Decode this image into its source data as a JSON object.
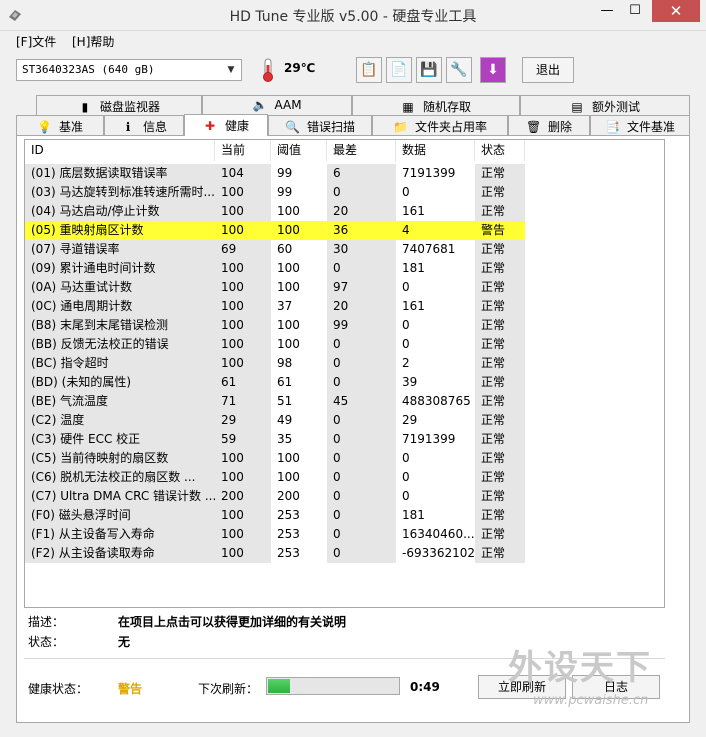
{
  "window": {
    "title": "HD Tune 专业版 v5.00 - 硬盘专业工具",
    "min": "—",
    "max": "☐",
    "close": "✕"
  },
  "menu": {
    "file": "[F]文件",
    "help": "[H]帮助"
  },
  "toolbar": {
    "drive": "ST3640323AS (640 gB)",
    "temperature": "29℃",
    "exit_label": "退出"
  },
  "tabs_top": [
    {
      "label": "磁盘监视器",
      "icon": "bar-chart-icon"
    },
    {
      "label": "AAM",
      "icon": "speaker-icon"
    },
    {
      "label": "随机存取",
      "icon": "scatter-icon"
    },
    {
      "label": "额外测试",
      "icon": "extra-test-icon"
    }
  ],
  "tabs_bottom": [
    {
      "label": "基准",
      "icon": "lightbulb-icon"
    },
    {
      "label": "信息",
      "icon": "info-icon"
    },
    {
      "label": "健康",
      "icon": "health-cross-icon"
    },
    {
      "label": "错误扫描",
      "icon": "magnifier-icon"
    },
    {
      "label": "文件夹占用率",
      "icon": "folder-icon"
    },
    {
      "label": "删除",
      "icon": "trash-icon"
    },
    {
      "label": "文件基准",
      "icon": "file-benchmark-icon"
    }
  ],
  "table": {
    "headers": [
      "ID",
      "当前",
      "阈值",
      "最差",
      "数据",
      "状态"
    ],
    "rows": [
      {
        "id": "(01) 底层数据读取错误率",
        "cur": "104",
        "thr": "99",
        "wst": "6",
        "dat": "7191399",
        "sta": "正常"
      },
      {
        "id": "(03) 马达旋转到标准转速所需时...",
        "cur": "100",
        "thr": "99",
        "wst": "0",
        "dat": "0",
        "sta": "正常"
      },
      {
        "id": "(04) 马达启动/停止计数",
        "cur": "100",
        "thr": "100",
        "wst": "20",
        "dat": "161",
        "sta": "正常"
      },
      {
        "id": "(05) 重映射扇区计数",
        "cur": "100",
        "thr": "100",
        "wst": "36",
        "dat": "4",
        "sta": "警告",
        "warn": true
      },
      {
        "id": "(07) 寻道错误率",
        "cur": "69",
        "thr": "60",
        "wst": "30",
        "dat": "7407681",
        "sta": "正常"
      },
      {
        "id": "(09) 累计通电时间计数",
        "cur": "100",
        "thr": "100",
        "wst": "0",
        "dat": "181",
        "sta": "正常"
      },
      {
        "id": "(0A) 马达重试计数",
        "cur": "100",
        "thr": "100",
        "wst": "97",
        "dat": "0",
        "sta": "正常"
      },
      {
        "id": "(0C) 通电周期计数",
        "cur": "100",
        "thr": "37",
        "wst": "20",
        "dat": "161",
        "sta": "正常"
      },
      {
        "id": "(B8) 末尾到末尾错误检测",
        "cur": "100",
        "thr": "100",
        "wst": "99",
        "dat": "0",
        "sta": "正常"
      },
      {
        "id": "(BB) 反馈无法校正的错误",
        "cur": "100",
        "thr": "100",
        "wst": "0",
        "dat": "0",
        "sta": "正常"
      },
      {
        "id": "(BC) 指令超时",
        "cur": "100",
        "thr": "98",
        "wst": "0",
        "dat": "2",
        "sta": "正常"
      },
      {
        "id": "(BD) (未知的属性)",
        "cur": "61",
        "thr": "61",
        "wst": "0",
        "dat": "39",
        "sta": "正常"
      },
      {
        "id": "(BE) 气流温度",
        "cur": "71",
        "thr": "51",
        "wst": "45",
        "dat": "488308765",
        "sta": "正常"
      },
      {
        "id": "(C2) 温度",
        "cur": "29",
        "thr": "49",
        "wst": "0",
        "dat": "29",
        "sta": "正常"
      },
      {
        "id": "(C3) 硬件 ECC 校正",
        "cur": "59",
        "thr": "35",
        "wst": "0",
        "dat": "7191399",
        "sta": "正常"
      },
      {
        "id": "(C5) 当前待映射的扇区数",
        "cur": "100",
        "thr": "100",
        "wst": "0",
        "dat": "0",
        "sta": "正常"
      },
      {
        "id": "(C6) 脱机无法校正的扇区数   ...",
        "cur": "100",
        "thr": "100",
        "wst": "0",
        "dat": "0",
        "sta": "正常"
      },
      {
        "id": "(C7) Ultra DMA CRC 错误计数 ...",
        "cur": "200",
        "thr": "200",
        "wst": "0",
        "dat": "0",
        "sta": "正常"
      },
      {
        "id": "(F0) 磁头悬浮时间",
        "cur": "100",
        "thr": "253",
        "wst": "0",
        "dat": "181",
        "sta": "正常"
      },
      {
        "id": "(F1) 从主设备写入寿命",
        "cur": "100",
        "thr": "253",
        "wst": "0",
        "dat": "16340460...",
        "sta": "正常"
      },
      {
        "id": "(F2) 从主设备读取寿命",
        "cur": "100",
        "thr": "253",
        "wst": "0",
        "dat": "-693362102",
        "sta": "正常"
      }
    ]
  },
  "details": {
    "desc_label": "描述：",
    "desc_value": "在项目上点击可以获得更加详细的有关说明",
    "state_label": "状态：",
    "state_value": "无"
  },
  "footer": {
    "health_label": "健康状态：",
    "health_value": "警告",
    "next_refresh_label": "下次刷新：",
    "progress_fraction": 0.17,
    "timer": "0:49",
    "refresh_label": "立即刷新",
    "log_label": "日志"
  },
  "watermark": {
    "text": "外设天下",
    "url": "www.pcwaishe.cn"
  },
  "colors": {
    "warn_row": "#ffff33",
    "health_warn": "#e0a800",
    "close_btn": "#c75050"
  }
}
